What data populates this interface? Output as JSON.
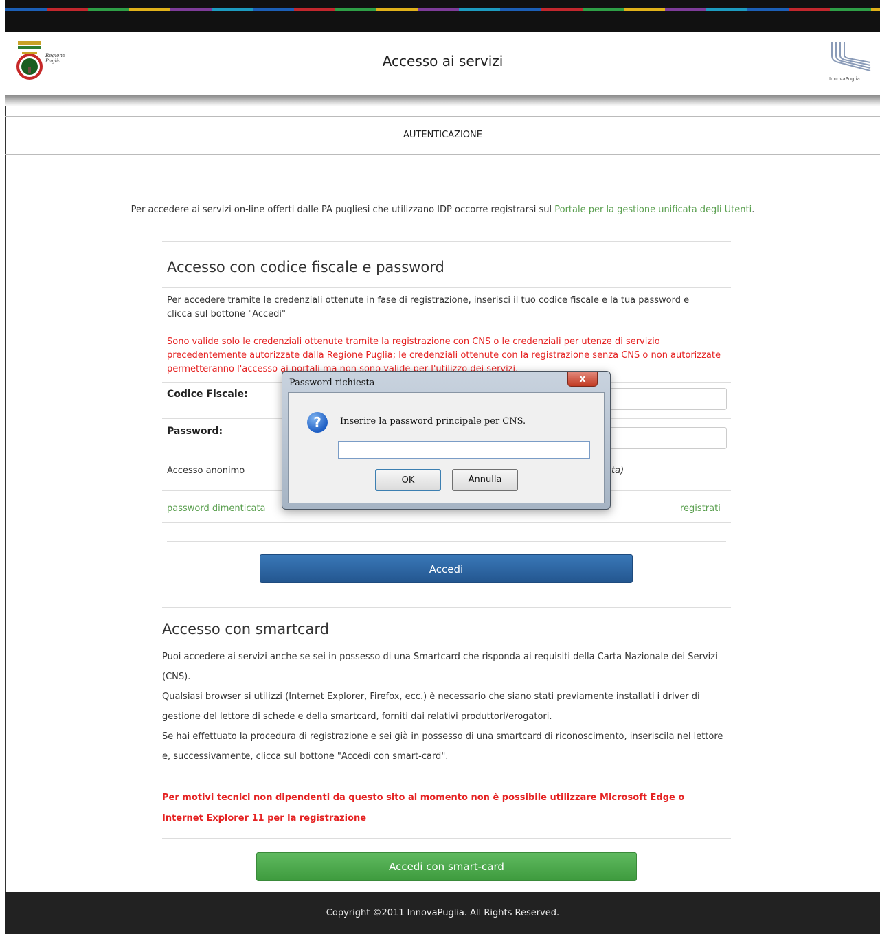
{
  "header": {
    "title": "Accesso ai servizi",
    "logo_left_text": "Regione Puglia",
    "logo_right_text": "InnovaPuglia"
  },
  "subnav": {
    "label": "AUTENTICAZIONE"
  },
  "intro": {
    "text": "Per accedere ai servizi on-line offerti dalle PA pugliesi che utilizzano IDP occorre registrarsi sul ",
    "link": "Portale per la gestione unificata degli Utenti",
    "after": "."
  },
  "login": {
    "heading": "Accesso con codice fiscale e password",
    "description": "Per accedere tramite le credenziali ottenute in fase di registrazione, inserisci il tuo codice fiscale e la tua password e clicca sul bottone \"Accedi\"",
    "warning": "Sono valide solo le credenziali ottenute tramite la registrazione con CNS o le credenziali per utenze di servizio precedentemente autorizzate dalla Regione Puglia; le credenziali ottenute con la registrazione senza CNS o non autorizzate permetteranno l'accesso ai portali ma non sono valide per l'utilizzo dei servizi.",
    "cf_label": "Codice Fiscale:",
    "password_label": "Password:",
    "anonymous_label": "Accesso anonimo",
    "anonymous_tail": "ta)",
    "forgot_link": "password dimenticata",
    "register_link": "registrati",
    "submit_label": "Accedi"
  },
  "smartcard": {
    "heading": "Accesso con smartcard",
    "p1": "Puoi accedere ai servizi anche se sei in possesso di una Smartcard che risponda ai requisiti della Carta Nazionale dei Servizi (CNS).",
    "p2": "Qualsiasi browser si utilizzi (Internet Explorer, Firefox, ecc.) è necessario che siano stati previamente installati i driver di gestione del lettore di schede e della smartcard, forniti dai relativi produttori/erogatori.",
    "p3": "Se hai effettuato la procedura di registrazione e sei già in possesso di una smartcard di riconoscimento, inseriscila nel lettore e, successivamente, clicca sul bottone \"Accedi con smart-card\".",
    "warning": "Per motivi tecnici non dipendenti da questo sito al momento non è possibile utilizzare Microsoft Edge o Internet Explorer 11 per la registrazione",
    "button_label": "Accedi con smart-card"
  },
  "footer": {
    "copyright": "Copyright ©2011 InnovaPuglia. All Rights Reserved."
  },
  "dialog": {
    "title": "Password richiesta",
    "close": "x",
    "message": "Inserire la password principale per CNS.",
    "icon": "question-icon",
    "ok_label": "OK",
    "cancel_label": "Annulla"
  },
  "colors": {
    "link_green": "#5a9f4f",
    "warning_red": "#e52222",
    "primary_blue": "#2c66a3",
    "smart_green": "#4caf50"
  }
}
